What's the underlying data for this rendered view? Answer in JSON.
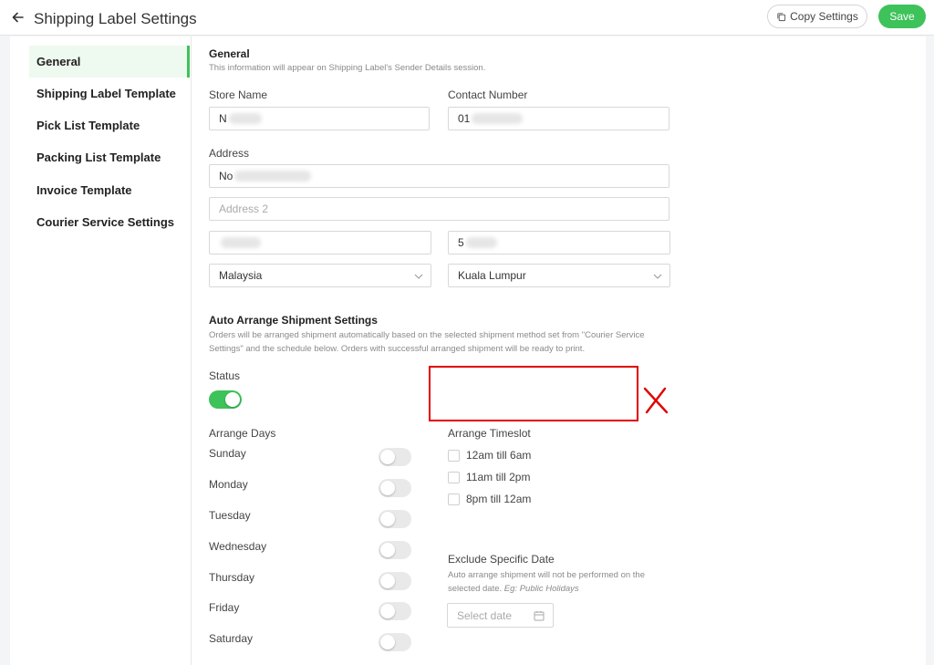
{
  "header": {
    "title": "Shipping Label Settings",
    "copy_label": "Copy Settings",
    "save_label": "Save"
  },
  "sidebar": {
    "items": [
      {
        "label": "General",
        "active": true
      },
      {
        "label": "Shipping Label Template"
      },
      {
        "label": "Pick List Template"
      },
      {
        "label": "Packing List Template"
      },
      {
        "label": "Invoice Template"
      },
      {
        "label": "Courier Service Settings"
      }
    ]
  },
  "general": {
    "title": "General",
    "desc": "This information will appear on Shipping Label's Sender Details session.",
    "store_name_label": "Store Name",
    "store_name_value": "N",
    "contact_label": "Contact Number",
    "contact_value": "01",
    "address_label": "Address",
    "address1_value": "No",
    "address2_placeholder": "Address 2",
    "city_value": "",
    "postcode_value": "5",
    "country_value": "Malaysia",
    "state_value": "Kuala Lumpur"
  },
  "auto_arrange": {
    "title": "Auto Arrange Shipment Settings",
    "desc_line1": "Orders will be arranged shipment automatically based on the selected shipment method set from \"Courier Service",
    "desc_line2": "Settings\" and the schedule below. Orders with successful arranged shipment will be ready to print.",
    "status_label": "Status",
    "status_on": true,
    "days_label": "Arrange Days",
    "days": [
      {
        "label": "Sunday",
        "on": false
      },
      {
        "label": "Monday",
        "on": false
      },
      {
        "label": "Tuesday",
        "on": false
      },
      {
        "label": "Wednesday",
        "on": false
      },
      {
        "label": "Thursday",
        "on": false
      },
      {
        "label": "Friday",
        "on": false
      },
      {
        "label": "Saturday",
        "on": false
      }
    ],
    "timeslot_label": "Arrange Timeslot",
    "timeslots": [
      "12am till 6am",
      "11am till 2pm",
      "8pm till 12am"
    ],
    "exclude_label": "Exclude Specific Date",
    "exclude_desc_line1": "Auto arrange shipment will not be performed on the",
    "exclude_desc_line2_prefix": "selected date.",
    "exclude_desc_example": "Eg: Public Holidays",
    "date_placeholder": "Select date"
  },
  "colors": {
    "accent": "#3ec25a",
    "annotation": "#e00000"
  }
}
